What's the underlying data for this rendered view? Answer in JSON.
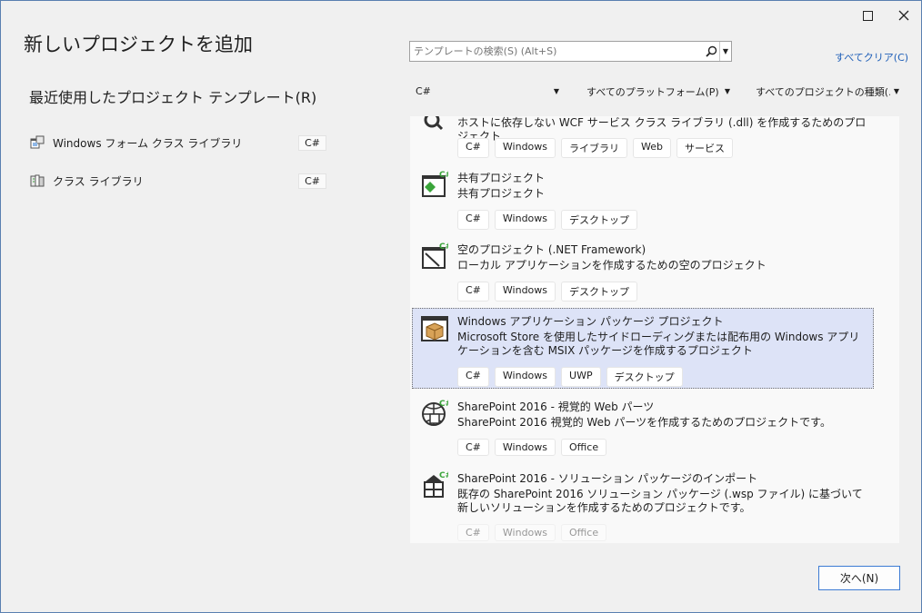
{
  "window": {
    "title": "新しいプロジェクトを追加"
  },
  "recent": {
    "heading": "最近使用したプロジェクト テンプレート(R)",
    "items": [
      {
        "label": "Windows フォーム クラス ライブラリ",
        "tag": "C#",
        "icon": "winforms-library-icon"
      },
      {
        "label": "クラス ライブラリ",
        "tag": "C#",
        "icon": "class-library-icon"
      }
    ]
  },
  "search": {
    "placeholder": "テンプレートの検索(S) (Alt+S)"
  },
  "clear_all": "すべてクリア(C)",
  "filters": {
    "language": "C#",
    "platform": "すべてのプラットフォーム(P)",
    "project_type": "すべてのプロジェクトの種類(..."
  },
  "templates": [
    {
      "name": "",
      "description": "ホストに依存しない WCF サービス クラス ライブラリ (.dll) を作成するためのプロジェクト",
      "tags": [
        "C#",
        "Windows",
        "ライブラリ",
        "Web",
        "サービス"
      ],
      "icon": "wcf-service-icon"
    },
    {
      "name": "共有プロジェクト",
      "description": "共有プロジェクト",
      "tags": [
        "C#",
        "Windows",
        "デスクトップ"
      ],
      "icon": "shared-project-icon"
    },
    {
      "name": "空のプロジェクト (.NET Framework)",
      "description": "ローカル アプリケーションを作成するための空のプロジェクト",
      "tags": [
        "C#",
        "Windows",
        "デスクトップ"
      ],
      "icon": "empty-project-icon"
    },
    {
      "name": "Windows アプリケーション パッケージ プロジェクト",
      "description": "Microsoft Store を使用したサイドローディングまたは配布用の Windows アプリケーションを含む MSIX パッケージを作成するプロジェクト",
      "tags": [
        "C#",
        "Windows",
        "UWP",
        "デスクトップ"
      ],
      "icon": "package-project-icon",
      "selected": true
    },
    {
      "name": "SharePoint 2016 - 視覚的 Web パーツ",
      "description": "SharePoint 2016 視覚的 Web パーツを作成するためのプロジェクトです。",
      "tags": [
        "C#",
        "Windows",
        "Office"
      ],
      "icon": "sharepoint-webpart-icon"
    },
    {
      "name": "SharePoint 2016 - ソリューション パッケージのインポート",
      "description": "既存の SharePoint 2016 ソリューション パッケージ (.wsp ファイル) に基づいて新しいソリューションを作成するためのプロジェクトです。",
      "tags": [
        "C#",
        "Windows",
        "Office"
      ],
      "icon": "sharepoint-import-icon"
    }
  ],
  "next_button": "次へ(N)",
  "colors": {
    "accent": "#3c7bd4",
    "selected_bg": "#dde3f7",
    "link": "#1f5fb8",
    "csharp_green": "#3aa53a"
  }
}
